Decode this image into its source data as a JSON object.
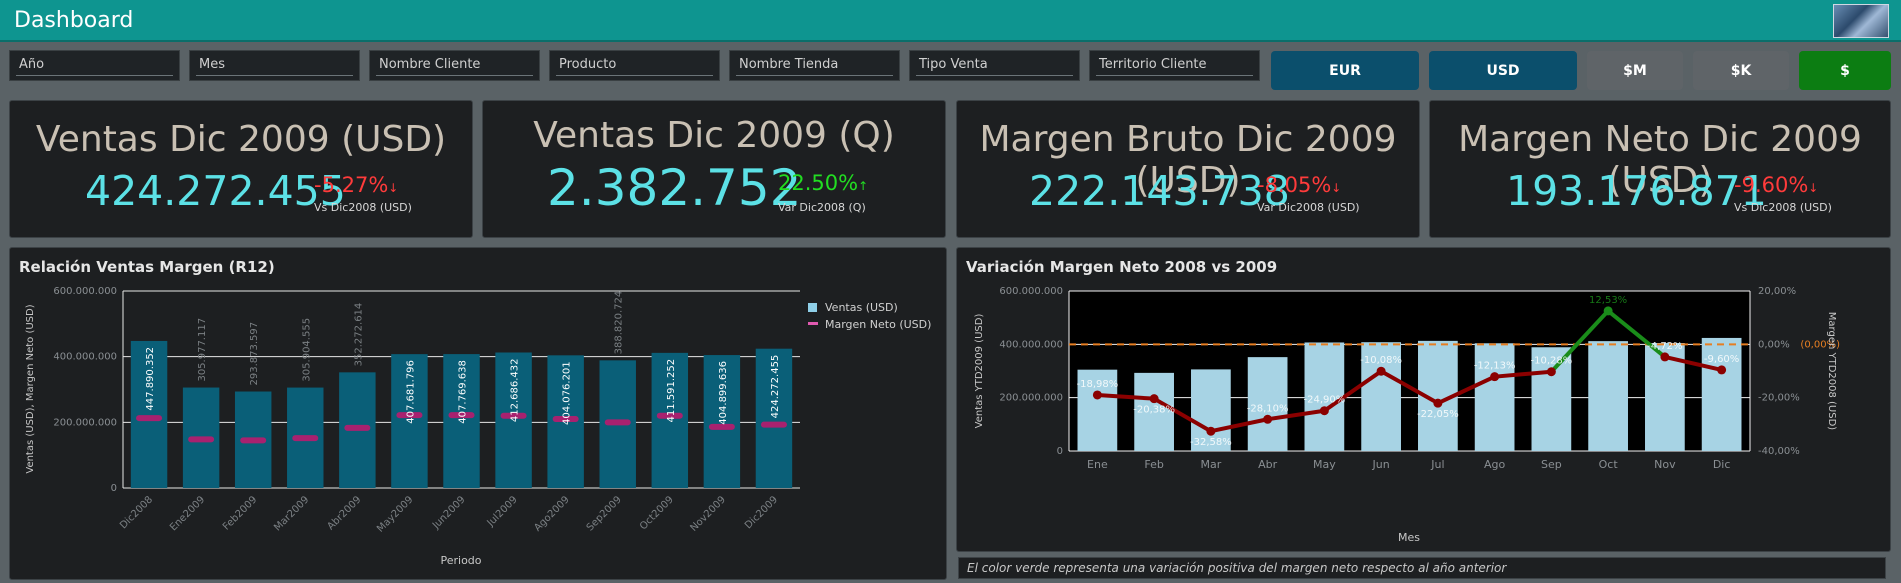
{
  "header": {
    "title": "Dashboard"
  },
  "filters": [
    "Año",
    "Mes",
    "Nombre Cliente",
    "Producto",
    "Nombre Tienda",
    "Tipo Venta",
    "Territorio Cliente"
  ],
  "buttons": [
    {
      "label": "EUR",
      "color": "#0b4f6c"
    },
    {
      "label": "USD",
      "color": "#0b4f6c"
    },
    {
      "label": "$M",
      "color": "#5f6468"
    },
    {
      "label": "$K",
      "color": "#5f6468"
    },
    {
      "label": "$",
      "color": "#0c7d12"
    }
  ],
  "kpis": [
    {
      "title": "Ventas Dic 2009 (USD)",
      "value": "424.272.455",
      "delta": "-5.27%",
      "arrow": "↓",
      "trend": "neg",
      "sub": "Vs Dic2008 (USD)"
    },
    {
      "title": "Ventas Dic 2009 (Q)",
      "value": "2.382.752",
      "delta": "22.50%",
      "arrow": "↑",
      "trend": "pos",
      "sub": "Var Dic2008 (Q)"
    },
    {
      "title": "Margen Bruto Dic 2009 (USD)",
      "value": "222.143.738",
      "delta": "-8.05%",
      "arrow": "↓",
      "trend": "neg",
      "sub": "Var Dic2008 (USD)"
    },
    {
      "title": "Margen Neto Dic 2009 (USD)",
      "value": "193.176.871",
      "delta": "-9.60%",
      "arrow": "↓",
      "trend": "neg",
      "sub": "Vs Dic2008 (USD)"
    }
  ],
  "chart_data": [
    {
      "type": "bar",
      "title": "Relación Ventas Margen (R12)",
      "xlabel": "Periodo",
      "ylabel": "Ventas (USD), Margen Neto (USD)",
      "ylim": [
        0,
        600000000
      ],
      "yticks": [
        "0",
        "200.000.000",
        "400.000.000",
        "600.000.000"
      ],
      "grid": true,
      "legend_position": "right",
      "colors": {
        "bar": "#0a5f78",
        "marker": "#a8216f"
      },
      "categories": [
        "Dic2008",
        "Ene2009",
        "Feb2009",
        "Mar2009",
        "Abr2009",
        "May2009",
        "Jun2009",
        "Jul2009",
        "Ago2009",
        "Sep2009",
        "Oct2009",
        "Nov2009",
        "Dic2009"
      ],
      "series": [
        {
          "name": "Ventas (USD)",
          "values": [
            447890352,
            305977117,
            293873597,
            305904555,
            352272614,
            407681796,
            407769638,
            412686432,
            404076201,
            388820724,
            411591252,
            404899636,
            424272455
          ],
          "labels": [
            "447.890.352",
            "305.977.117",
            "293.873.597",
            "305.904.555",
            "352.272.614",
            "407.681.796",
            "407.769.638",
            "412.686.432",
            "404.076.201",
            "388.820.724",
            "411.591.252",
            "404.899.636",
            "424.272.455"
          ]
        },
        {
          "name": "Margen Neto (USD)",
          "values": [
            213000000,
            148000000,
            145000000,
            152000000,
            183000000,
            222000000,
            222000000,
            220000000,
            210000000,
            200000000,
            220000000,
            186000000,
            193000000
          ]
        }
      ]
    },
    {
      "type": "bar",
      "title": "Variación Margen Neto 2008 vs 2009",
      "xlabel": "Mes",
      "ylabel": "Ventas YTD2009 (USD)",
      "y2label": "Margen YTD2008 (USD)",
      "ylim": [
        0,
        600000000
      ],
      "y2lim": [
        -40,
        20
      ],
      "yticks": [
        "0",
        "200.000.000",
        "400.000.000",
        "600.000.000"
      ],
      "y2ticks": [
        "-40,00%",
        "-20,00%",
        "0,00%",
        "20,00%"
      ],
      "reference_label": "(0,00%)",
      "colors": {
        "bar": "#a7d3e4",
        "line": "#8b0000",
        "line_positive": "#1a8c1a",
        "reference": "#e67e22"
      },
      "categories": [
        "Ene",
        "Feb",
        "Mar",
        "Abr",
        "May",
        "Jun",
        "Jul",
        "Ago",
        "Sep",
        "Oct",
        "Nov",
        "Dic"
      ],
      "series": [
        {
          "name": "Ventas YTD2009 (USD)",
          "values": [
            305000000,
            293000000,
            306000000,
            352000000,
            407000000,
            408000000,
            413000000,
            404000000,
            389000000,
            412000000,
            405000000,
            424000000
          ]
        },
        {
          "name": "Margen YTD2008 (USD)",
          "values": [
            -18.98,
            -20.38,
            -32.58,
            -28.1,
            -24.9,
            -10.08,
            -22.05,
            -12.13,
            -10.28,
            12.53,
            -4.72,
            -9.6
          ],
          "labels": [
            "-18,98%",
            "-20,38%",
            "-32,58%",
            "-28,10%",
            "-24,90%",
            "-10,08%",
            "-22,05%",
            "-12,13%",
            "-10,28%",
            "12,53%",
            "-4,72%",
            "-9,60%"
          ]
        }
      ]
    }
  ],
  "footnote": "El color verde representa una variación positiva del margen neto respecto al año anterior"
}
